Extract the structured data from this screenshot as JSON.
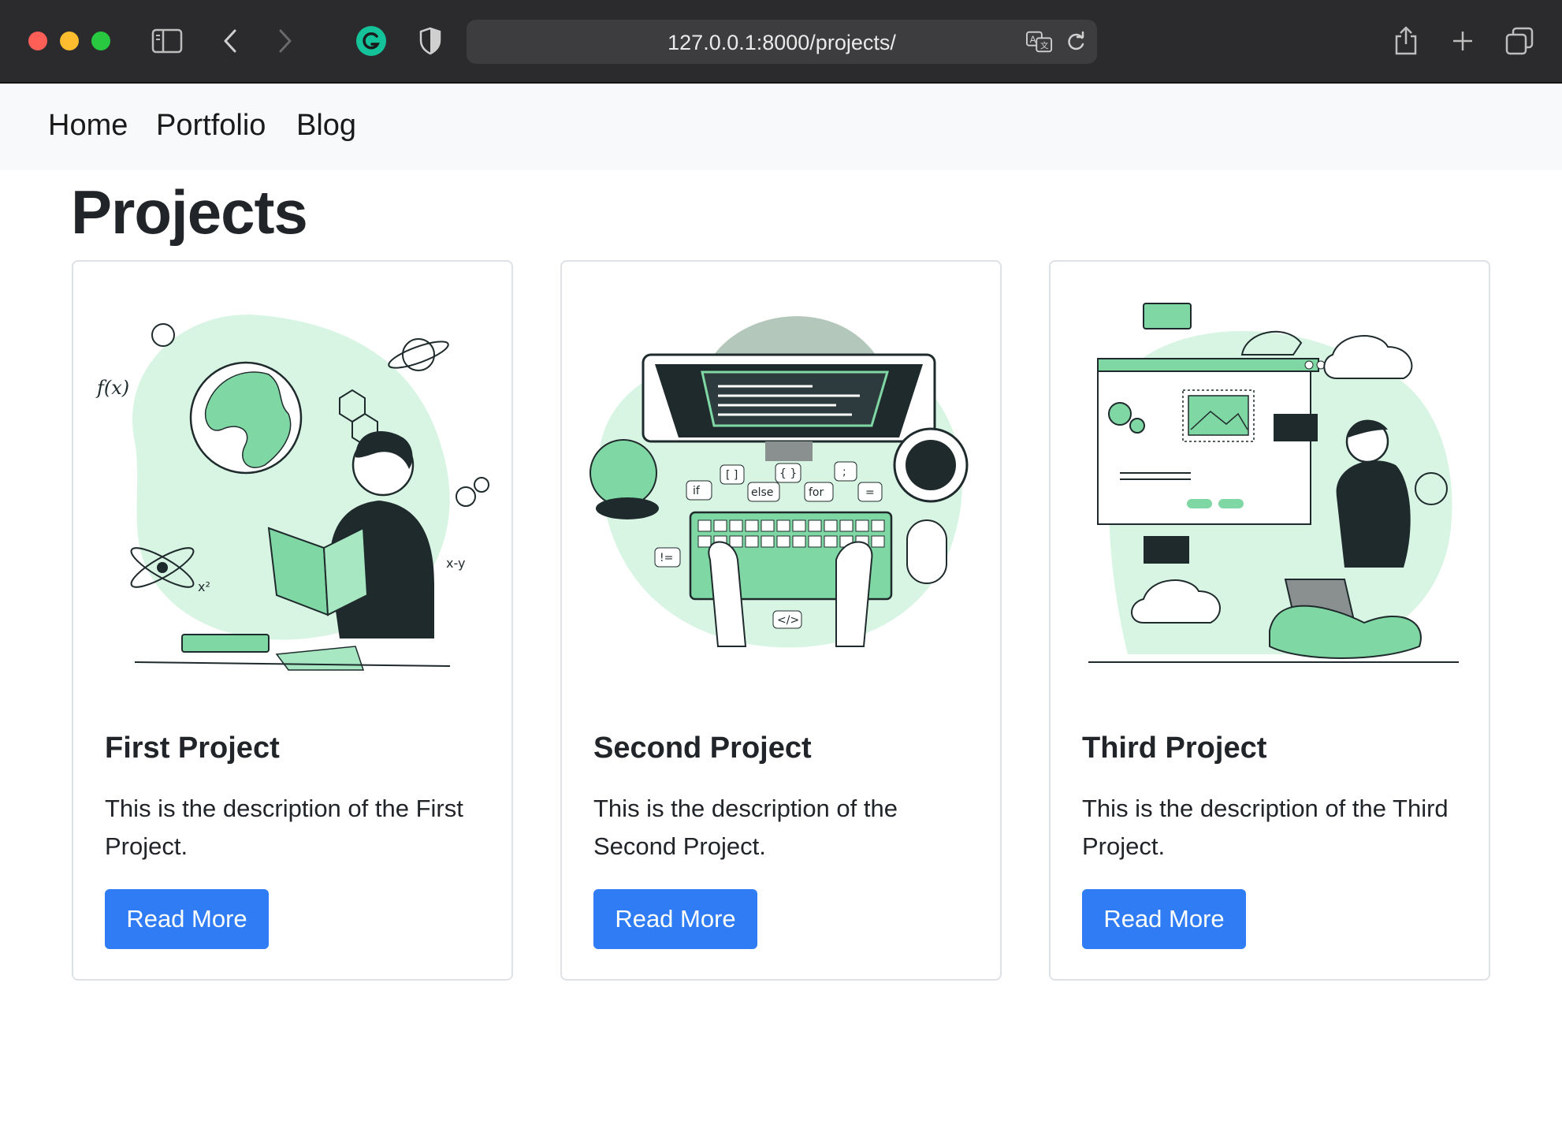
{
  "browser": {
    "url": "127.0.0.1:8000/projects/"
  },
  "nav": {
    "links": [
      "Home",
      "Portfolio",
      "Blog"
    ]
  },
  "page": {
    "title": "Projects"
  },
  "projects": [
    {
      "title": "First Project",
      "description": "This is the description of the First Project.",
      "button": "Read More"
    },
    {
      "title": "Second Project",
      "description": "This is the description of the Second Project.",
      "button": "Read More"
    },
    {
      "title": "Third Project",
      "description": "This is the description of the Third Project.",
      "button": "Read More"
    }
  ],
  "illustration_code_labels": [
    "if",
    "[ ]",
    "else",
    "{ }",
    "for",
    ";",
    "=",
    "!=",
    "</>"
  ],
  "colors": {
    "accent_green": "#7fd8a4",
    "light_green": "#d8f5e4",
    "button_blue": "#2f7cf5",
    "dark": "#1f2a2c"
  }
}
